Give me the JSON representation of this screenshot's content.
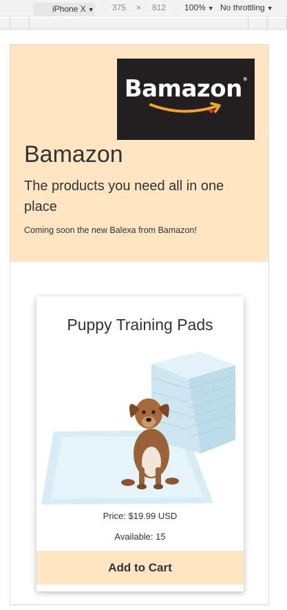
{
  "devtools": {
    "device": "iPhone X",
    "width": "375",
    "times": "×",
    "height": "812",
    "zoom": "100%",
    "throttle": "No throttling"
  },
  "hero": {
    "logo_text": "Bamazon",
    "logo_reg": "®",
    "title": "Bamazon",
    "subtitle": "The products you need all in one place",
    "note": "Coming soon the new Balexa from Bamazon!"
  },
  "product": {
    "name": "Puppy Training Pads",
    "price": "Price: $19.99 USD",
    "available": "Available: 15",
    "button": "Add to Cart"
  },
  "colors": {
    "hero_bg": "#fee5c3",
    "logo_bg": "#231f20",
    "logo_smile": "#f6a623"
  }
}
